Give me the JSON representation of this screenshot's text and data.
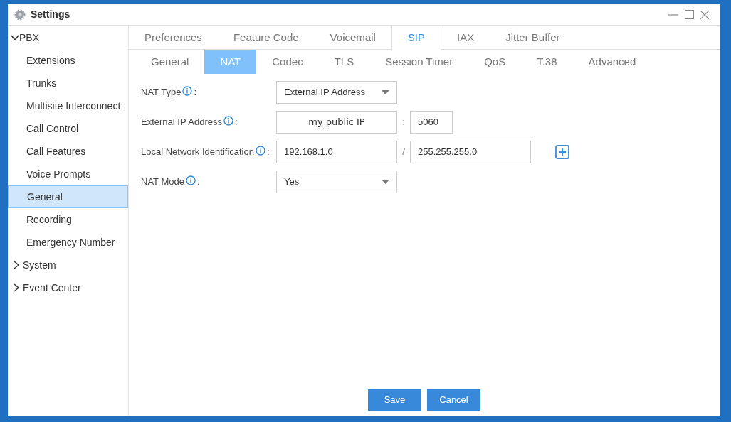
{
  "window": {
    "title": "Settings"
  },
  "sidebar": {
    "items": [
      {
        "label": "PBX",
        "expanded": true,
        "selected": false,
        "children": [
          {
            "label": "Extensions",
            "selected": false
          },
          {
            "label": "Trunks",
            "selected": false
          },
          {
            "label": "Multisite Interconnect",
            "selected": false
          },
          {
            "label": "Call Control",
            "selected": false
          },
          {
            "label": "Call Features",
            "selected": false
          },
          {
            "label": "Voice Prompts",
            "selected": false
          },
          {
            "label": "General",
            "selected": true
          },
          {
            "label": "Recording",
            "selected": false
          },
          {
            "label": "Emergency Number",
            "selected": false
          }
        ]
      },
      {
        "label": "System",
        "expanded": false,
        "selected": false
      },
      {
        "label": "Event Center",
        "expanded": false,
        "selected": false
      }
    ]
  },
  "tabs": [
    {
      "label": "Preferences",
      "selected": false
    },
    {
      "label": "Feature Code",
      "selected": false
    },
    {
      "label": "Voicemail",
      "selected": false
    },
    {
      "label": "SIP",
      "selected": true
    },
    {
      "label": "IAX",
      "selected": false
    },
    {
      "label": "Jitter Buffer",
      "selected": false
    }
  ],
  "subtabs": [
    {
      "label": "General",
      "selected": false
    },
    {
      "label": "NAT",
      "selected": true
    },
    {
      "label": "Codec",
      "selected": false
    },
    {
      "label": "TLS",
      "selected": false
    },
    {
      "label": "Session Timer",
      "selected": false
    },
    {
      "label": "QoS",
      "selected": false
    },
    {
      "label": "T.38",
      "selected": false
    },
    {
      "label": "Advanced",
      "selected": false
    }
  ],
  "form": [
    {
      "kind": "select",
      "label": "NAT Type",
      "suffix": ":",
      "value": "External IP Address"
    },
    {
      "kind": "pair",
      "label": "External IP Address",
      "suffix": ":",
      "values": [
        "my public IP",
        "5060"
      ],
      "separator": ":",
      "add_button": false
    },
    {
      "kind": "pair",
      "label": "Local Network Identification",
      "suffix": ":",
      "values": [
        "192.168.1.0",
        "255.255.255.0"
      ],
      "separator": "/",
      "add_button": true
    },
    {
      "kind": "select",
      "label": "NAT Mode",
      "suffix": ":",
      "value": "Yes"
    }
  ],
  "buttons": [
    "Save",
    "Cancel"
  ]
}
